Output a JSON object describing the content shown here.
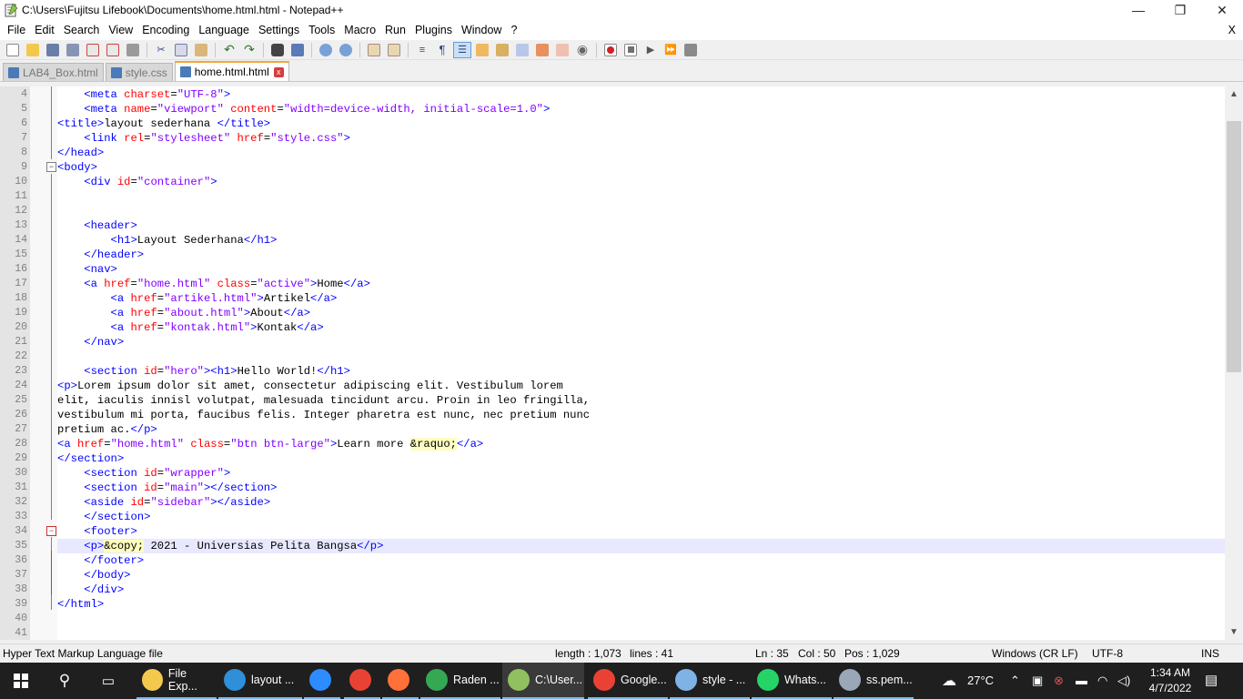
{
  "window": {
    "title": "C:\\Users\\Fujitsu Lifebook\\Documents\\home.html.html - Notepad++",
    "minimize": "—",
    "restore": "❐",
    "close": "✕"
  },
  "menu": {
    "items": [
      "File",
      "Edit",
      "Search",
      "View",
      "Encoding",
      "Language",
      "Settings",
      "Tools",
      "Macro",
      "Run",
      "Plugins",
      "Window",
      "?"
    ],
    "close_doc": "X"
  },
  "tabs": [
    {
      "label": "LAB4_Box.html",
      "active": false
    },
    {
      "label": "style.css",
      "active": false
    },
    {
      "label": "home.html.html",
      "active": true
    }
  ],
  "editor": {
    "current_line": 35,
    "lines": [
      {
        "n": "4",
        "code": "    <meta charset=\"UTF-8\">"
      },
      {
        "n": "5",
        "code": "    <meta name=\"viewport\" content=\"width=device-width, initial-scale=1.0\">"
      },
      {
        "n": "6",
        "code": "<title>layout sederhana </title>"
      },
      {
        "n": "7",
        "code": "    <link rel=\"stylesheet\" href=\"style.css\">"
      },
      {
        "n": "8",
        "code": "</head>"
      },
      {
        "n": "9",
        "code": "<body>"
      },
      {
        "n": "10",
        "code": "    <div id=\"container\">"
      },
      {
        "n": "11",
        "code": ""
      },
      {
        "n": "12",
        "code": ""
      },
      {
        "n": "13",
        "code": "    <header>"
      },
      {
        "n": "14",
        "code": "        <h1>Layout Sederhana</h1>"
      },
      {
        "n": "15",
        "code": "    </header>"
      },
      {
        "n": "16",
        "code": "    <nav>"
      },
      {
        "n": "17",
        "code": "    <a href=\"home.html\" class=\"active\">Home</a>"
      },
      {
        "n": "18",
        "code": "        <a href=\"artikel.html\">Artikel</a>"
      },
      {
        "n": "19",
        "code": "        <a href=\"about.html\">About</a>"
      },
      {
        "n": "20",
        "code": "        <a href=\"kontak.html\">Kontak</a>"
      },
      {
        "n": "21",
        "code": "    </nav>"
      },
      {
        "n": "22",
        "code": ""
      },
      {
        "n": "23",
        "code": "    <section id=\"hero\"><h1>Hello World!</h1>"
      },
      {
        "n": "24",
        "code": "<p>Lorem ipsum dolor sit amet, consectetur adipiscing elit. Vestibulum lorem"
      },
      {
        "n": "25",
        "code": "elit, iaculis innisl volutpat, malesuada tincidunt arcu. Proin in leo fringilla,"
      },
      {
        "n": "26",
        "code": "vestibulum mi porta, faucibus felis. Integer pharetra est nunc, nec pretium nunc"
      },
      {
        "n": "27",
        "code": "pretium ac.</p>"
      },
      {
        "n": "28",
        "code": "<a href=\"home.html\" class=\"btn btn-large\">Learn more &raquo;</a>"
      },
      {
        "n": "29",
        "code": "</section>"
      },
      {
        "n": "30",
        "code": "    <section id=\"wrapper\">"
      },
      {
        "n": "31",
        "code": "    <section id=\"main\"></section>"
      },
      {
        "n": "32",
        "code": "    <aside id=\"sidebar\"></aside>"
      },
      {
        "n": "33",
        "code": "    </section>"
      },
      {
        "n": "34",
        "code": "    <footer>"
      },
      {
        "n": "35",
        "code": "    <p>&copy; 2021 - Universias Pelita Bangsa</p>"
      },
      {
        "n": "36",
        "code": "    </footer>"
      },
      {
        "n": "37",
        "code": "    </body>"
      },
      {
        "n": "38",
        "code": "    </div>"
      },
      {
        "n": "39",
        "code": "</html>"
      },
      {
        "n": "40",
        "code": ""
      },
      {
        "n": "41",
        "code": ""
      }
    ]
  },
  "status": {
    "file_type": "Hyper Text Markup Language file",
    "length": "length : 1,073",
    "lines": "lines : 41",
    "ln": "Ln : 35",
    "col": "Col : 50",
    "pos": "Pos : 1,029",
    "eol": "Windows (CR LF)",
    "encoding": "UTF-8",
    "mode": "INS"
  },
  "taskbar": {
    "items": [
      {
        "label": "File Exp...",
        "color": "#f2c94c"
      },
      {
        "label": "layout ...",
        "color": "#2f8fd8"
      },
      {
        "label": "",
        "color": "#2d8cff"
      },
      {
        "label": "",
        "color": "#e94235"
      },
      {
        "label": "",
        "color": "#ff7139"
      },
      {
        "label": "Raden ...",
        "color": "#34a853"
      },
      {
        "label": "C:\\User...",
        "color": "#90c060"
      },
      {
        "label": "Google...",
        "color": "#e94235"
      },
      {
        "label": "style - ...",
        "color": "#7fb3e6"
      },
      {
        "label": "Whats...",
        "color": "#25d366"
      },
      {
        "label": "ss.pem...",
        "color": "#9aa7b8"
      }
    ],
    "weather": "27°C",
    "time": "1:34 AM",
    "date": "4/7/2022"
  }
}
